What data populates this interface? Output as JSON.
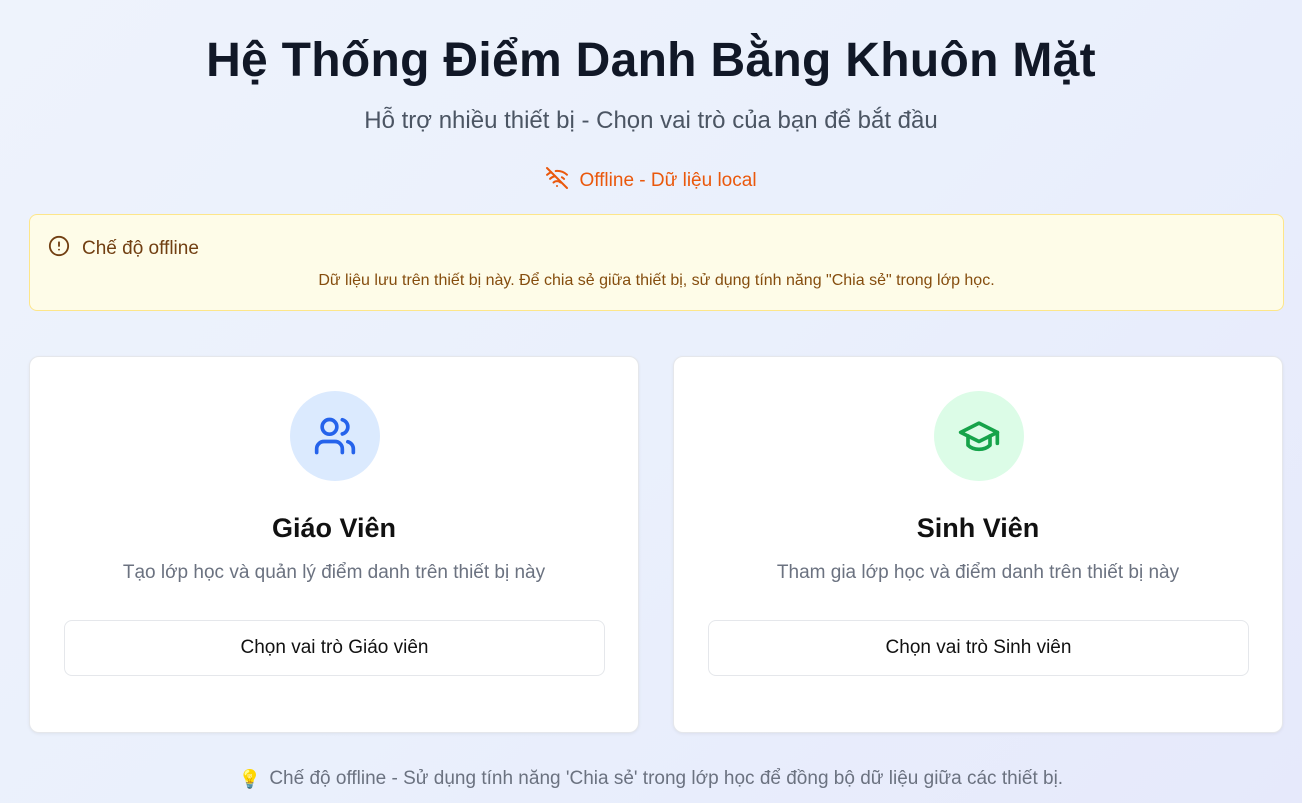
{
  "header": {
    "title": "Hệ Thống Điểm Danh Bằng Khuôn Mặt",
    "subtitle": "Hỗ trợ nhiều thiết bị - Chọn vai trò của bạn để bắt đầu"
  },
  "status": {
    "icon": "wifi-off-icon",
    "text": "Offline - Dữ liệu local",
    "color": "#ea580c"
  },
  "alert": {
    "icon": "alert-circle-icon",
    "title": "Chế độ offline",
    "message": "Dữ liệu lưu trên thiết bị này. Để chia sẻ giữa thiết bị, sử dụng tính năng \"Chia sẻ\" trong lớp học."
  },
  "roles": {
    "teacher": {
      "icon": "users-icon",
      "title": "Giáo Viên",
      "description": "Tạo lớp học và quản lý điểm danh trên thiết bị này",
      "button": "Chọn vai trò Giáo viên",
      "accent": "#2563eb"
    },
    "student": {
      "icon": "graduation-cap-icon",
      "title": "Sinh Viên",
      "description": "Tham gia lớp học và điểm danh trên thiết bị này",
      "button": "Chọn vai trò Sinh viên",
      "accent": "#16a34a"
    }
  },
  "footer": {
    "icon": "💡",
    "text": "Chế độ offline - Sử dụng tính năng 'Chia sẻ' trong lớp học để đồng bộ dữ liệu giữa các thiết bị."
  }
}
